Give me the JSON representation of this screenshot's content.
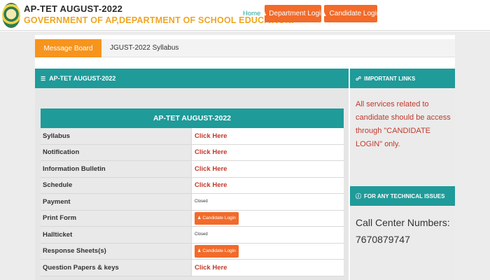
{
  "header": {
    "title": "AP-TET AUGUST-2022",
    "subtitle": "GOVERNMENT OF AP,DEPARTMENT OF SCHOOL EDUCATION.",
    "home": "Home",
    "dept_login": "Department Login",
    "cand_login": "Candidate Login",
    "logo_icon": "ap-state-emblem",
    "dept_icon": "user-icon",
    "cand_icon": "graduation-cap-icon"
  },
  "message_board": {
    "label": "Message Board",
    "text": "JGUST-2022 Syllabus"
  },
  "left_panel": {
    "heading": "AP-TET AUGUST-2022",
    "heading_icon": "list-icon",
    "table_title": "AP-TET AUGUST-2022",
    "rows": [
      {
        "label": "Syllabus",
        "value": "Click Here",
        "kind": "link"
      },
      {
        "label": "Notification",
        "value": "Click Here",
        "kind": "link"
      },
      {
        "label": "Information Bulletin",
        "value": "Click Here",
        "kind": "link"
      },
      {
        "label": "Schedule",
        "value": "Click Here",
        "kind": "link"
      },
      {
        "label": "Payment",
        "value": "Closed",
        "kind": "closed"
      },
      {
        "label": "Print Form",
        "value": "Candidate Login",
        "kind": "button"
      },
      {
        "label": "Hallticket",
        "value": "Closed",
        "kind": "closed"
      },
      {
        "label": "Response Sheets(s)",
        "value": "Candidate Login",
        "kind": "button"
      },
      {
        "label": "Question Papers & keys",
        "value": "Click Here",
        "kind": "link"
      }
    ]
  },
  "right_panel": {
    "important_heading": "IMPORTANT LINKS",
    "important_icon": "link-icon",
    "notice": "All services related to candidate should be access through \"CANDIDATE LOGIN\" only.",
    "tech_heading": "FOR ANY TECHNICAL ISSUES",
    "tech_icon": "info-icon",
    "call_label": "Call Center Numbers:",
    "call_number": "7670879747"
  },
  "colors": {
    "teal": "#1f9b9a",
    "orange": "#f26b2a",
    "message_orange": "#f7941d",
    "title_gold": "#f0a51f",
    "link_red": "#c0392b"
  }
}
